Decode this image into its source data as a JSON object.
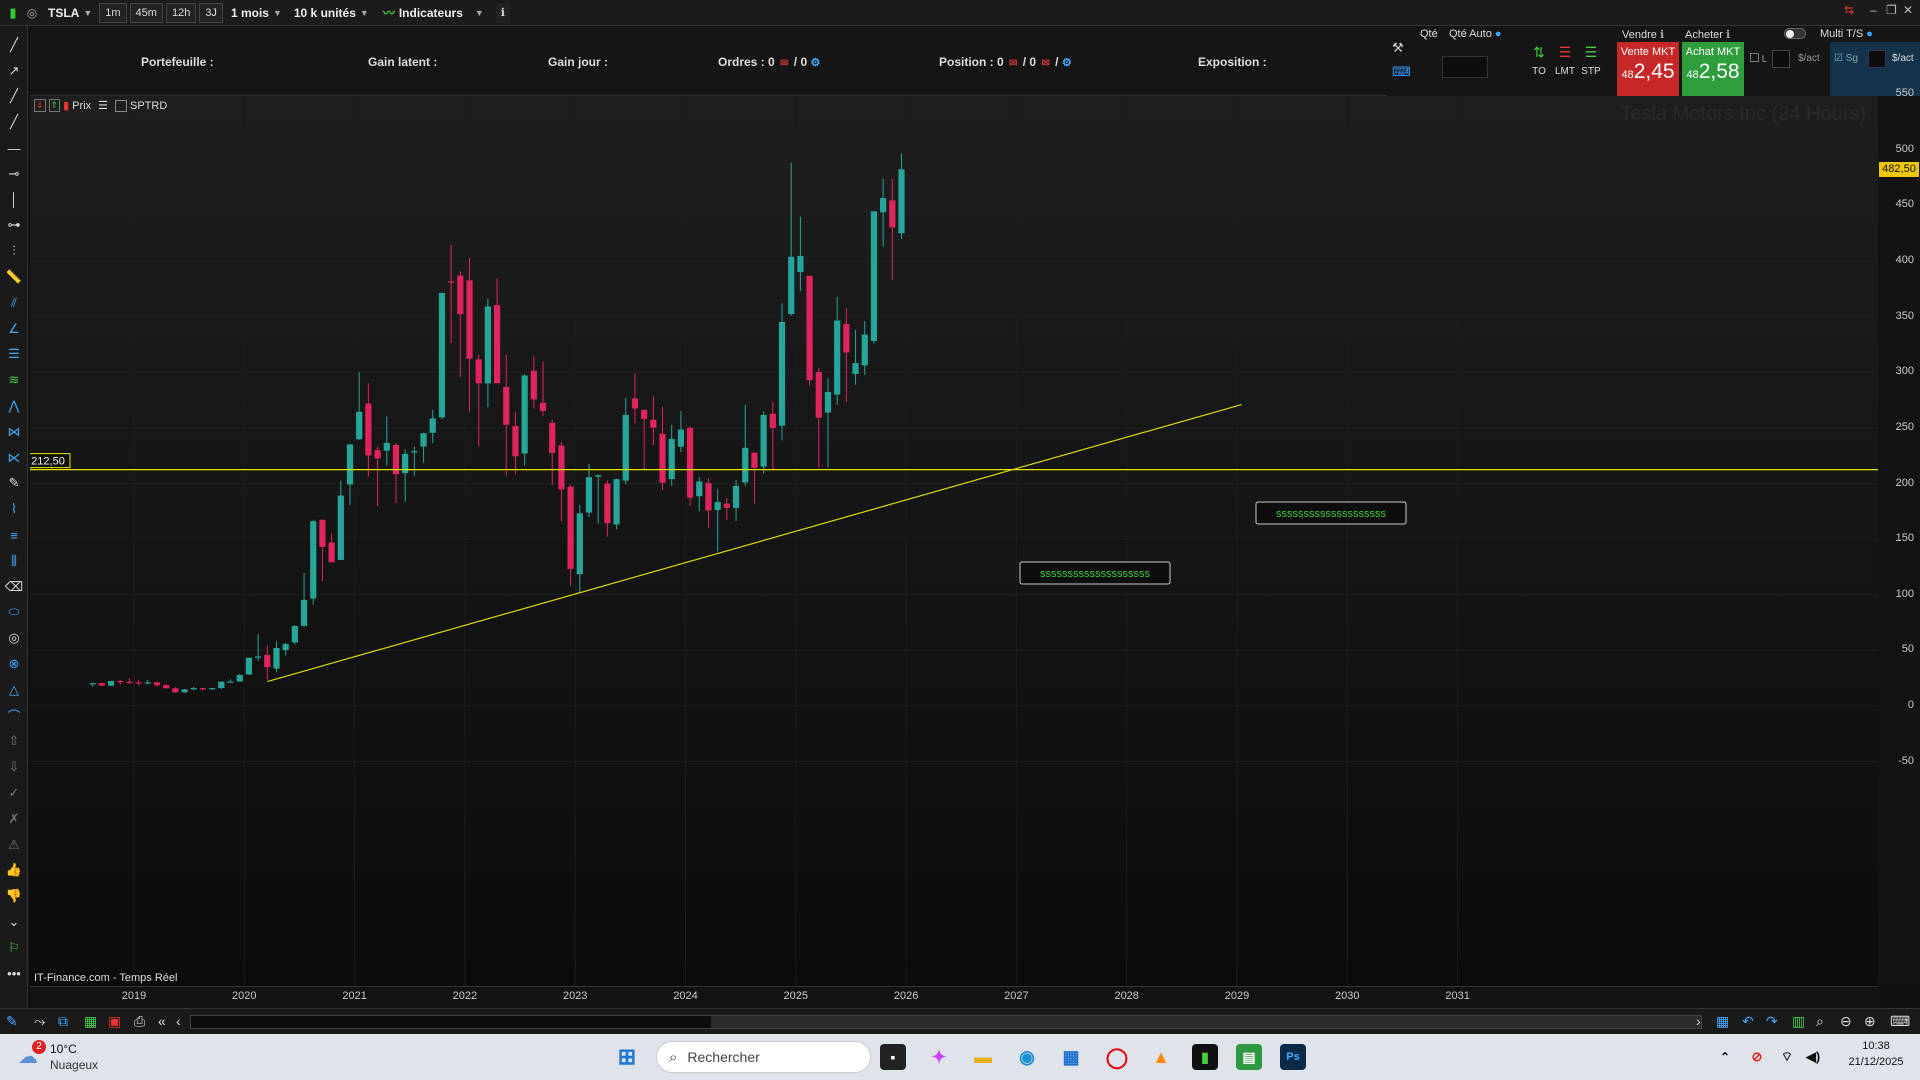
{
  "toolbar": {
    "symbol": "TSLA",
    "intervals": [
      "1m",
      "45m",
      "12h",
      "3J"
    ],
    "period": "1 mois",
    "units": "10 k unités",
    "indicators_label": "Indicateurs"
  },
  "portfolio": {
    "portefeuille": "Portefeuille :",
    "gain_latent": "Gain latent :",
    "gain_jour": "Gain jour :",
    "ordres": "Ordres : 0",
    "ordres_sub": "/ 0",
    "position": "Position : 0",
    "position_sub": "/ 0",
    "position_sub2": "/",
    "exposition": "Exposition :"
  },
  "order_panel": {
    "qte": "Qté",
    "qte_auto": "Qté Auto",
    "vendre": "Vendre",
    "acheter": "Acheter",
    "multi_ts": "Multi T/S",
    "order_types": [
      "TO",
      "LMT",
      "STP"
    ],
    "sell_label": "Vente MKT",
    "sell_price_small": "48",
    "sell_price_big": "2,45",
    "buy_label": "Achat MKT",
    "buy_price_small": "48",
    "buy_price_big": "2,58",
    "cb_l": "L",
    "cb_sact": "$/act",
    "cb_sg": "Sg",
    "cb_sact2": "$/act"
  },
  "chart_header": {
    "prix_label": "Prix",
    "sptrd_label": "SPTRD",
    "watermark": "Tesla Motors Inc (24 Hours)",
    "source": "IT-Finance.com - Temps Réel",
    "hline_label": "212,50",
    "last_price_label": "482,50",
    "annotation1": "ssssssssssssssssssss",
    "annotation2": "ssssssssssssssssssss"
  },
  "chart_data": {
    "type": "candlestick",
    "ylim": [
      -65,
      580
    ],
    "yticks": [
      550,
      500,
      450,
      400,
      350,
      300,
      250,
      200,
      150,
      100,
      50,
      0,
      -50
    ],
    "xticks": [
      "2019",
      "2020",
      "2021",
      "2022",
      "2023",
      "2024",
      "2025",
      "2026",
      "2027",
      "2028",
      "2029",
      "2030",
      "2031"
    ],
    "hline": 212.5,
    "trendline": {
      "from": [
        "2020-03",
        22
      ],
      "to": [
        "2029-01",
        271
      ]
    },
    "up_color": "#26a69a",
    "down_color": "#e0245e",
    "candles": [
      {
        "d": "2018-08",
        "o": 20.1,
        "h": 20.8,
        "l": 17.5,
        "c": 20.5
      },
      {
        "d": "2018-09",
        "o": 20.5,
        "h": 21.0,
        "l": 17.9,
        "c": 18.3
      },
      {
        "d": "2018-10",
        "o": 18.3,
        "h": 22.6,
        "l": 18.0,
        "c": 22.5
      },
      {
        "d": "2018-11",
        "o": 22.5,
        "h": 23.5,
        "l": 18.9,
        "c": 21.8
      },
      {
        "d": "2018-12",
        "o": 21.8,
        "h": 25.0,
        "l": 19.6,
        "c": 21.3
      },
      {
        "d": "2019-01",
        "o": 21.3,
        "h": 23.6,
        "l": 18.6,
        "c": 20.4
      },
      {
        "d": "2019-02",
        "o": 20.4,
        "h": 23.5,
        "l": 19.4,
        "c": 21.3
      },
      {
        "d": "2019-03",
        "o": 21.3,
        "h": 21.8,
        "l": 17.2,
        "c": 18.7
      },
      {
        "d": "2019-04",
        "o": 18.7,
        "h": 19.7,
        "l": 15.8,
        "c": 15.9
      },
      {
        "d": "2019-05",
        "o": 15.9,
        "h": 17.0,
        "l": 11.8,
        "c": 12.3
      },
      {
        "d": "2019-06",
        "o": 12.3,
        "h": 15.2,
        "l": 11.8,
        "c": 14.9
      },
      {
        "d": "2019-07",
        "o": 14.9,
        "h": 17.5,
        "l": 14.3,
        "c": 16.1
      },
      {
        "d": "2019-08",
        "o": 16.1,
        "h": 16.2,
        "l": 13.7,
        "c": 15.0
      },
      {
        "d": "2019-09",
        "o": 15.0,
        "h": 16.2,
        "l": 14.5,
        "c": 16.1
      },
      {
        "d": "2019-10",
        "o": 16.1,
        "h": 22.0,
        "l": 15.2,
        "c": 21.9
      },
      {
        "d": "2019-11",
        "o": 21.9,
        "h": 24.1,
        "l": 20.9,
        "c": 22.0
      },
      {
        "d": "2019-12",
        "o": 22.0,
        "h": 29.0,
        "l": 21.9,
        "c": 27.9
      },
      {
        "d": "2020-01",
        "o": 28.3,
        "h": 40.0,
        "l": 28.1,
        "c": 43.4
      },
      {
        "d": "2020-02",
        "o": 44.0,
        "h": 64.6,
        "l": 40.4,
        "c": 44.5
      },
      {
        "d": "2020-03",
        "o": 46.0,
        "h": 54.3,
        "l": 23.4,
        "c": 34.9
      },
      {
        "d": "2020-04",
        "o": 33.6,
        "h": 58.0,
        "l": 30.3,
        "c": 52.1
      },
      {
        "d": "2020-05",
        "o": 50.3,
        "h": 57.0,
        "l": 45.5,
        "c": 55.7
      },
      {
        "d": "2020-06",
        "o": 57.2,
        "h": 72.5,
        "l": 55.2,
        "c": 71.9
      },
      {
        "d": "2020-07",
        "o": 72.0,
        "h": 119.7,
        "l": 71.2,
        "c": 95.4
      },
      {
        "d": "2020-08",
        "o": 96.6,
        "h": 167.5,
        "l": 91.2,
        "c": 166.1
      },
      {
        "d": "2020-09",
        "o": 167.4,
        "h": 166.0,
        "l": 112.0,
        "c": 143.0
      },
      {
        "d": "2020-10",
        "o": 147.0,
        "h": 155.0,
        "l": 129.6,
        "c": 129.3
      },
      {
        "d": "2020-11",
        "o": 131.3,
        "h": 202.6,
        "l": 131.4,
        "c": 189.2
      },
      {
        "d": "2020-12",
        "o": 199.2,
        "h": 231.7,
        "l": 180.4,
        "c": 235.2
      },
      {
        "d": "2021-01",
        "o": 239.8,
        "h": 300.1,
        "l": 239.1,
        "c": 264.5
      },
      {
        "d": "2021-02",
        "o": 271.8,
        "h": 290.1,
        "l": 206.3,
        "c": 225.2
      },
      {
        "d": "2021-03",
        "o": 230.0,
        "h": 233.3,
        "l": 179.8,
        "c": 222.6
      },
      {
        "d": "2021-04",
        "o": 229.5,
        "h": 260.3,
        "l": 216.1,
        "c": 236.5
      },
      {
        "d": "2021-05",
        "o": 234.6,
        "h": 236.2,
        "l": 182.3,
        "c": 208.4
      },
      {
        "d": "2021-06",
        "o": 209.3,
        "h": 230.6,
        "l": 183.6,
        "c": 226.6
      },
      {
        "d": "2021-07",
        "o": 227.9,
        "h": 233.3,
        "l": 206.9,
        "c": 229.1
      },
      {
        "d": "2021-08",
        "o": 233.3,
        "h": 245.6,
        "l": 218.7,
        "c": 245.2
      },
      {
        "d": "2021-09",
        "o": 245.6,
        "h": 266.3,
        "l": 236.4,
        "c": 258.5
      },
      {
        "d": "2021-10",
        "o": 259.5,
        "h": 371.7,
        "l": 257.7,
        "c": 371.3
      },
      {
        "d": "2021-11",
        "o": 381.7,
        "h": 414.5,
        "l": 326.2,
        "c": 381.6
      },
      {
        "d": "2021-12",
        "o": 386.9,
        "h": 390.9,
        "l": 295.4,
        "c": 352.3
      },
      {
        "d": "2022-01",
        "o": 382.6,
        "h": 402.7,
        "l": 264.0,
        "c": 312.2
      },
      {
        "d": "2022-02",
        "o": 311.7,
        "h": 315.9,
        "l": 233.3,
        "c": 290.1
      },
      {
        "d": "2022-03",
        "o": 290.0,
        "h": 366.3,
        "l": 268.5,
        "c": 359.2
      },
      {
        "d": "2022-04",
        "o": 360.4,
        "h": 384.3,
        "l": 290.8,
        "c": 290.3
      },
      {
        "d": "2022-05",
        "o": 286.9,
        "h": 315.9,
        "l": 206.9,
        "c": 252.8
      },
      {
        "d": "2022-06",
        "o": 251.7,
        "h": 264.2,
        "l": 208.7,
        "c": 224.5
      },
      {
        "d": "2022-07",
        "o": 227.0,
        "h": 298.3,
        "l": 216.2,
        "c": 297.1
      },
      {
        "d": "2022-08",
        "o": 301.3,
        "h": 314.7,
        "l": 267.4,
        "c": 275.6
      },
      {
        "d": "2022-09",
        "o": 272.6,
        "h": 310.0,
        "l": 260.8,
        "c": 265.3
      },
      {
        "d": "2022-10",
        "o": 254.5,
        "h": 257.5,
        "l": 198.6,
        "c": 227.5
      },
      {
        "d": "2022-11",
        "o": 234.1,
        "h": 237.4,
        "l": 166.2,
        "c": 194.7
      },
      {
        "d": "2022-12",
        "o": 197.1,
        "h": 198.9,
        "l": 108.2,
        "c": 123.2
      },
      {
        "d": "2023-01",
        "o": 118.5,
        "h": 180.7,
        "l": 101.8,
        "c": 173.2
      },
      {
        "d": "2023-02",
        "o": 173.9,
        "h": 217.7,
        "l": 169.9,
        "c": 205.7
      },
      {
        "d": "2023-03",
        "o": 206.2,
        "h": 207.8,
        "l": 163.9,
        "c": 207.5
      },
      {
        "d": "2023-04",
        "o": 199.9,
        "h": 202.7,
        "l": 152.4,
        "c": 164.3
      },
      {
        "d": "2023-05",
        "o": 163.2,
        "h": 204.5,
        "l": 158.8,
        "c": 203.9
      },
      {
        "d": "2023-06",
        "o": 202.6,
        "h": 276.99,
        "l": 199.4,
        "c": 261.8
      },
      {
        "d": "2023-07",
        "o": 276.5,
        "h": 299.3,
        "l": 254.1,
        "c": 267.4
      },
      {
        "d": "2023-08",
        "o": 266.3,
        "h": 266.5,
        "l": 212.4,
        "c": 258.1
      },
      {
        "d": "2023-09",
        "o": 257.3,
        "h": 278.98,
        "l": 234.6,
        "c": 250.2
      },
      {
        "d": "2023-10",
        "o": 244.8,
        "h": 268.9,
        "l": 194.1,
        "c": 200.8
      },
      {
        "d": "2023-11",
        "o": 204.0,
        "h": 252.8,
        "l": 197.9,
        "c": 240.1
      },
      {
        "d": "2023-12",
        "o": 233.1,
        "h": 265.1,
        "l": 228.2,
        "c": 248.5
      },
      {
        "d": "2024-01",
        "o": 250.1,
        "h": 251.2,
        "l": 180.1,
        "c": 187.3
      },
      {
        "d": "2024-02",
        "o": 188.5,
        "h": 205.6,
        "l": 175.0,
        "c": 201.9
      },
      {
        "d": "2024-03",
        "o": 200.5,
        "h": 204.5,
        "l": 160.5,
        "c": 175.8
      },
      {
        "d": "2024-04",
        "o": 176.2,
        "h": 194.8,
        "l": 138.8,
        "c": 183.3
      },
      {
        "d": "2024-05",
        "o": 182.0,
        "h": 187.0,
        "l": 167.3,
        "c": 178.1
      },
      {
        "d": "2024-06",
        "o": 178.1,
        "h": 203.2,
        "l": 166.4,
        "c": 197.9
      },
      {
        "d": "2024-07",
        "o": 201.0,
        "h": 271.0,
        "l": 197.5,
        "c": 232.1
      },
      {
        "d": "2024-08",
        "o": 227.7,
        "h": 228.2,
        "l": 182.0,
        "c": 214.1
      },
      {
        "d": "2024-09",
        "o": 215.3,
        "h": 264.9,
        "l": 209.0,
        "c": 261.6
      },
      {
        "d": "2024-10",
        "o": 262.7,
        "h": 273.5,
        "l": 212.1,
        "c": 249.9
      },
      {
        "d": "2024-11",
        "o": 252.0,
        "h": 361.9,
        "l": 238.9,
        "c": 345.2
      },
      {
        "d": "2024-12",
        "o": 352.4,
        "h": 488.5,
        "l": 350.8,
        "c": 403.8
      },
      {
        "d": "2025-01",
        "o": 390.1,
        "h": 439.7,
        "l": 373.0,
        "c": 404.6
      },
      {
        "d": "2025-02",
        "o": 386.7,
        "h": 384.0,
        "l": 288.0,
        "c": 292.9
      },
      {
        "d": "2025-03",
        "o": 300.3,
        "h": 303.9,
        "l": 214.3,
        "c": 259.2
      },
      {
        "d": "2025-04",
        "o": 263.8,
        "h": 294.9,
        "l": 214.3,
        "c": 282.2
      },
      {
        "d": "2025-05",
        "o": 280.0,
        "h": 367.7,
        "l": 270.8,
        "c": 346.5
      },
      {
        "d": "2025-06",
        "o": 343.5,
        "h": 357.5,
        "l": 273.2,
        "c": 317.7
      },
      {
        "d": "2025-07",
        "o": 298.5,
        "h": 338.0,
        "l": 288.8,
        "c": 308.3
      },
      {
        "d": "2025-08",
        "o": 306.2,
        "h": 345.98,
        "l": 297.8,
        "c": 333.9
      },
      {
        "d": "2025-09",
        "o": 328.2,
        "h": 444.5,
        "l": 325.6,
        "c": 444.7
      },
      {
        "d": "2025-10",
        "o": 443.8,
        "h": 474.1,
        "l": 413.0,
        "c": 456.6
      },
      {
        "d": "2025-11",
        "o": 454.5,
        "h": 474.1,
        "l": 382.8,
        "c": 430.2
      },
      {
        "d": "2025-12",
        "o": 425.0,
        "h": 496.5,
        "l": 420.0,
        "c": 482.5
      }
    ]
  },
  "bottom": {
    "weather_temp": "10°C",
    "weather_desc": "Nuageux",
    "weather_badge": "2",
    "search_placeholder": "Rechercher",
    "time": "10:38",
    "date": "21/12/2025"
  }
}
